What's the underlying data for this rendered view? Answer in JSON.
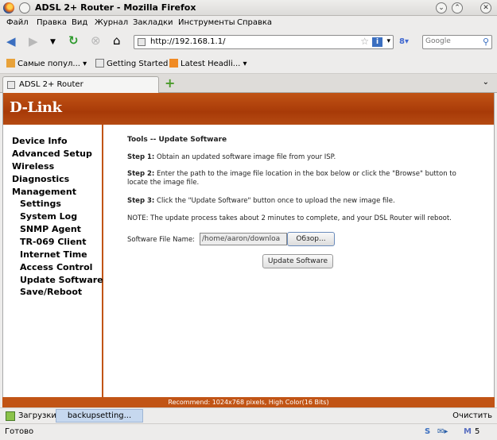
{
  "window": {
    "title": "ADSL 2+ Router - Mozilla Firefox"
  },
  "menubar": [
    "Файл",
    "Правка",
    "Вид",
    "Журнал",
    "Закладки",
    "Инструменты",
    "Справка"
  ],
  "navbar": {
    "url": "http://192.168.1.1/",
    "search_placeholder": "Google"
  },
  "bookmarks": [
    "Самые попул...",
    "Getting Started",
    "Latest Headli..."
  ],
  "tab": {
    "label": "ADSL 2+ Router"
  },
  "page": {
    "logo": "D-Link",
    "sidebar": [
      "Device Info",
      "Advanced Setup",
      "Wireless",
      "Diagnostics",
      "Management",
      "Settings",
      "System Log",
      "SNMP Agent",
      "TR-069 Client",
      "Internet Time",
      "Access Control",
      "Update Software",
      "Save/Reboot"
    ],
    "heading": "Tools -- Update Software",
    "step1_label": "Step 1:",
    "step1_text": " Obtain an updated software image file from your ISP.",
    "step2_label": "Step 2:",
    "step2_text": " Enter the path to the image file location in the box below or click the \"Browse\" button to locate the image file.",
    "step3_label": "Step 3:",
    "step3_text": " Click the \"Update Software\" button once to upload the new image file.",
    "note": "NOTE: The update process takes about 2 minutes to complete, and your DSL Router will reboot.",
    "file_label": "Software File Name:",
    "file_value": "/home/aaron/downloa",
    "browse_label": "Обзор...",
    "update_label": "Update Software",
    "recommend": "Recommend: 1024x768 pixels, High Color(16 Bits)"
  },
  "downloads": {
    "label": "Загрузки",
    "item": "backupsetting...",
    "clear": "Очистить"
  },
  "status": {
    "text": "Готово",
    "mail_count": "5"
  },
  "colors": {
    "brand": "#c15415",
    "brand_dark": "#a83a08"
  }
}
